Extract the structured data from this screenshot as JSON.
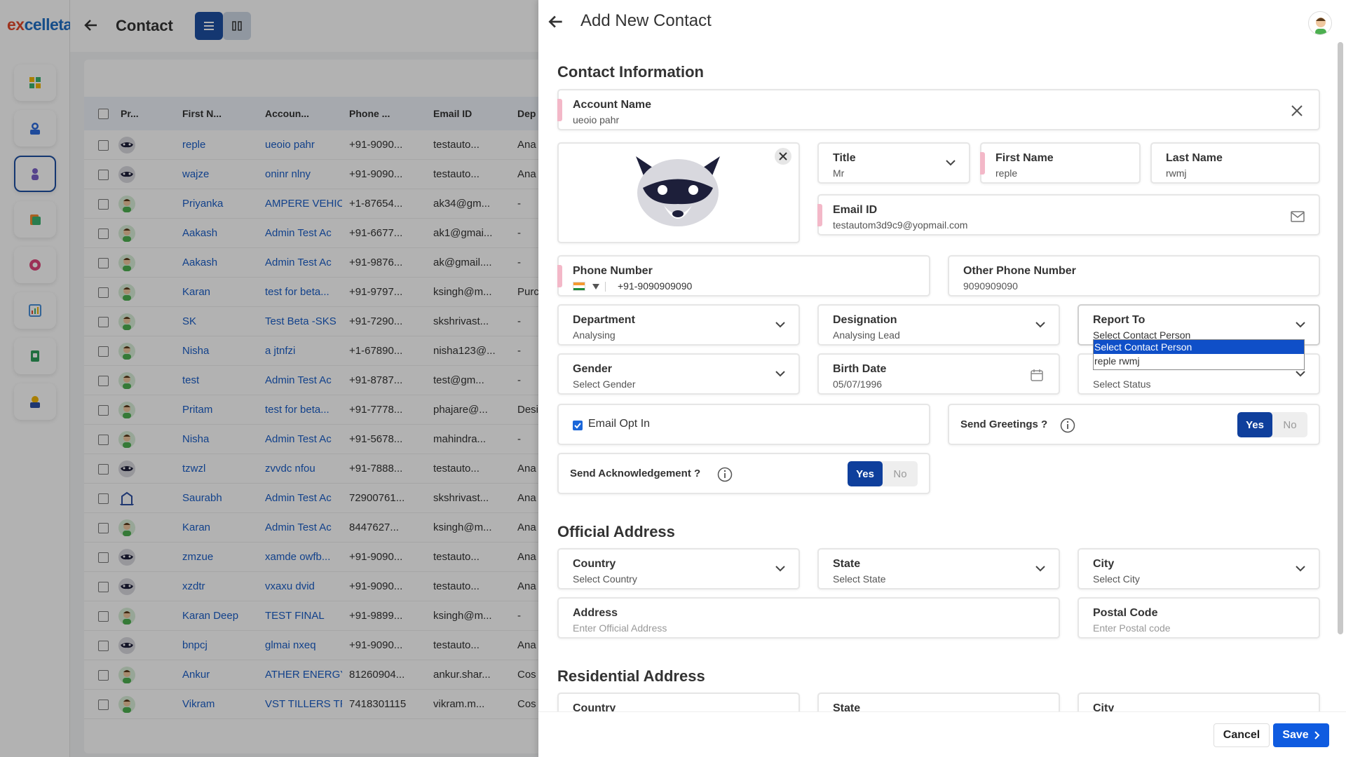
{
  "app": {
    "logo_prefix": "ex",
    "logo_rest": "celleta"
  },
  "sidebar": {
    "items": [
      {
        "name": "dashboard-icon"
      },
      {
        "name": "accounts-icon"
      },
      {
        "name": "contacts-icon"
      },
      {
        "name": "documents-icon"
      },
      {
        "name": "settings-icon"
      },
      {
        "name": "reports-icon"
      },
      {
        "name": "tasks-icon"
      },
      {
        "name": "finance-icon"
      }
    ]
  },
  "background": {
    "title": "Contact",
    "columns": [
      "Pr...",
      "First N...",
      "Accoun...",
      "Phone ...",
      "Email ID",
      "Dep"
    ],
    "rows": [
      {
        "avatar": "raccoon",
        "first": "reple",
        "account": "ueoio pahr",
        "phone": "+91-9090...",
        "email": "testauto...",
        "dept": "Ana"
      },
      {
        "avatar": "raccoon",
        "first": "wajze",
        "account": "oninr nlny",
        "phone": "+91-9090...",
        "email": "testauto...",
        "dept": "Ana"
      },
      {
        "avatar": "person",
        "first": "Priyanka",
        "account": "AMPERE VEHICL",
        "phone": "+1-87654...",
        "email": "ak34@gm...",
        "dept": "-"
      },
      {
        "avatar": "person",
        "first": "Aakash",
        "account": "Admin Test Ac",
        "phone": "+91-6677...",
        "email": "ak1@gmai...",
        "dept": "-"
      },
      {
        "avatar": "person",
        "first": "Aakash",
        "account": "Admin Test Ac",
        "phone": "+91-9876...",
        "email": "ak@gmail....",
        "dept": "-"
      },
      {
        "avatar": "person",
        "first": "Karan",
        "account": "test for beta...",
        "phone": "+91-9797...",
        "email": "ksingh@m...",
        "dept": "Purc"
      },
      {
        "avatar": "person",
        "first": "SK",
        "account": "Test Beta -SKS",
        "phone": "+91-7290...",
        "email": "skshrivast...",
        "dept": "-"
      },
      {
        "avatar": "person",
        "first": "Nisha",
        "account": "a jtnfzi",
        "phone": "+1-67890...",
        "email": "nisha123@...",
        "dept": "-"
      },
      {
        "avatar": "person",
        "first": "test",
        "account": "Admin Test Ac",
        "phone": "+91-8787...",
        "email": "test@gm...",
        "dept": "-"
      },
      {
        "avatar": "person",
        "first": "Pritam",
        "account": "test for beta...",
        "phone": "+91-7778...",
        "email": "phajare@...",
        "dept": "Desi"
      },
      {
        "avatar": "person",
        "first": "Nisha",
        "account": "Admin Test Ac",
        "phone": "+91-5678...",
        "email": "mahindra...",
        "dept": "-"
      },
      {
        "avatar": "raccoon",
        "first": "tzwzl",
        "account": "zvvdc nfou",
        "phone": "+91-7888...",
        "email": "testauto...",
        "dept": "Ana"
      },
      {
        "avatar": "building",
        "first": "Saurabh",
        "account": "Admin Test Ac",
        "phone": "72900761...",
        "email": "skshrivast...",
        "dept": "Ana"
      },
      {
        "avatar": "person",
        "first": "Karan",
        "account": "Admin Test Ac",
        "phone": "8447627...",
        "email": "ksingh@m...",
        "dept": "Ana"
      },
      {
        "avatar": "raccoon",
        "first": "zmzue",
        "account": "xamde owfb...",
        "phone": "+91-9090...",
        "email": "testauto...",
        "dept": "Ana"
      },
      {
        "avatar": "raccoon",
        "first": "xzdtr",
        "account": "vxaxu dvid",
        "phone": "+91-9090...",
        "email": "testauto...",
        "dept": "Ana"
      },
      {
        "avatar": "person",
        "first": "Karan Deep",
        "account": "TEST FINAL",
        "phone": "+91-9899...",
        "email": "ksingh@m...",
        "dept": "-"
      },
      {
        "avatar": "raccoon",
        "first": "bnpcj",
        "account": "glmai nxeq",
        "phone": "+91-9090...",
        "email": "testauto...",
        "dept": "Ana"
      },
      {
        "avatar": "person",
        "first": "Ankur",
        "account": "ATHER ENERGY",
        "phone": "81260904...",
        "email": "ankur.shar...",
        "dept": "Cos"
      },
      {
        "avatar": "person",
        "first": "Vikram",
        "account": "VST TILLERS TR",
        "phone": "7418301115",
        "email": "vikram.m...",
        "dept": "Cos"
      }
    ]
  },
  "drawer": {
    "title": "Add New Contact",
    "sections": {
      "contact_info": "Contact Information",
      "official_address": "Official Address",
      "residential_address": "Residential Address"
    },
    "fields": {
      "account_name": {
        "label": "Account Name",
        "value": "ueoio pahr"
      },
      "title": {
        "label": "Title",
        "value": "Mr"
      },
      "first_name": {
        "label": "First Name",
        "value": "reple"
      },
      "last_name": {
        "label": "Last Name",
        "value": "rwmj"
      },
      "email": {
        "label": "Email ID",
        "value": "testautom3d9c9@yopmail.com"
      },
      "phone": {
        "label": "Phone Number",
        "value": "+91-9090909090"
      },
      "other_phone": {
        "label": "Other Phone Number",
        "value": "9090909090"
      },
      "department": {
        "label": "Department",
        "value": "Analysing"
      },
      "designation": {
        "label": "Designation",
        "value": "Analysing Lead"
      },
      "report_to": {
        "label": "Report To",
        "value": "Select Contact Person"
      },
      "gender": {
        "label": "Gender",
        "value": "Select Gender"
      },
      "birth_date": {
        "label": "Birth Date",
        "value": "05/07/1996"
      },
      "status": {
        "value": "Select Status"
      },
      "email_opt_in": {
        "label": "Email Opt In",
        "checked": true
      },
      "send_greetings": {
        "label": "Send Greetings ?",
        "yes": "Yes",
        "no": "No",
        "selected": "Yes"
      },
      "send_ack": {
        "label": "Send Acknowledgement ?",
        "yes": "Yes",
        "no": "No",
        "selected": "Yes"
      },
      "off_country": {
        "label": "Country",
        "value": "Select Country"
      },
      "off_state": {
        "label": "State",
        "value": "Select State"
      },
      "off_city": {
        "label": "City",
        "value": "Select City"
      },
      "off_address": {
        "label": "Address",
        "value": "Enter Official Address"
      },
      "off_postal": {
        "label": "Postal Code",
        "value": "Enter Postal code"
      },
      "res_country": {
        "label": "Country"
      },
      "res_state": {
        "label": "State"
      },
      "res_city": {
        "label": "City"
      }
    },
    "report_to_options": [
      {
        "label": "Select Contact Person",
        "selected": true
      },
      {
        "label": "reple rwmj",
        "selected": false
      }
    ],
    "footer": {
      "cancel": "Cancel",
      "save": "Save"
    }
  },
  "colors": {
    "primary": "#0f3f9c",
    "save": "#0f5be0",
    "link": "#1a5ec7",
    "required_marker": "#f3b8c8"
  }
}
